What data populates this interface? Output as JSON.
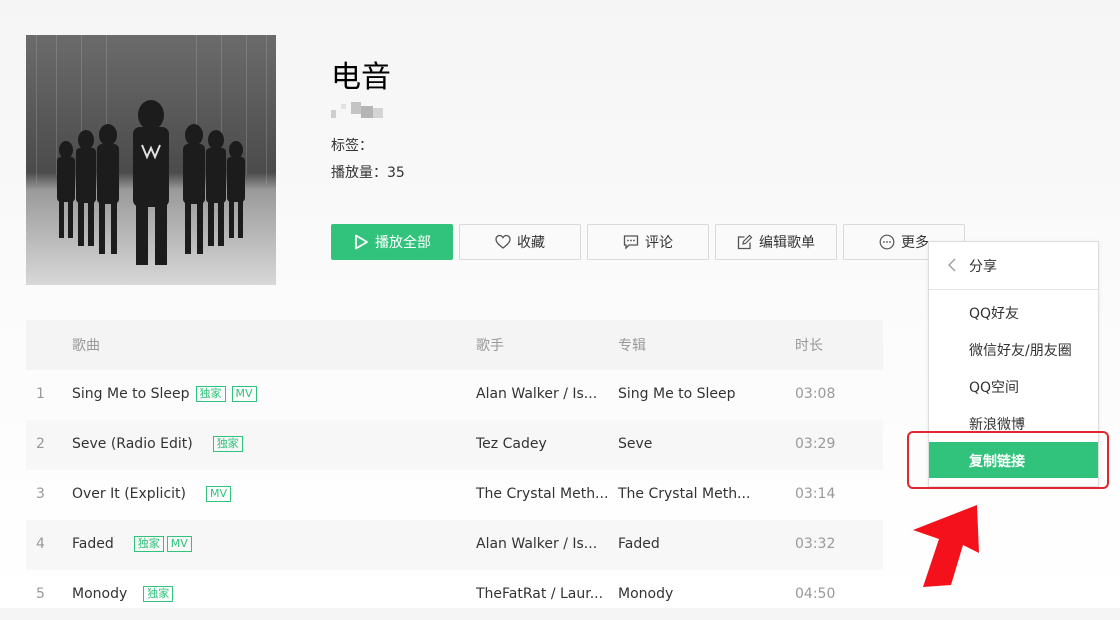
{
  "playlist": {
    "title": "电音",
    "tags_label": "标签：",
    "plays_label": "播放量：",
    "plays_value": "35"
  },
  "actions": {
    "play_all": "播放全部",
    "favorite": "收藏",
    "comment": "评论",
    "edit": "编辑歌单",
    "more": "更多"
  },
  "table": {
    "headers": {
      "song": "歌曲",
      "singer": "歌手",
      "album": "专辑",
      "duration": "时长"
    },
    "rows": [
      {
        "idx": "1",
        "name": "Sing Me to Sleep",
        "tags": [
          "独家",
          "MV"
        ],
        "singer": "Alan Walker / Is...",
        "album": "Sing Me to Sleep",
        "duration": "03:08"
      },
      {
        "idx": "2",
        "name": "Seve (Radio Edit)",
        "tags": [
          "独家"
        ],
        "singer": "Tez Cadey",
        "album": "Seve",
        "duration": "03:29"
      },
      {
        "idx": "3",
        "name": "Over It (Explicit)",
        "tags": [
          "MV"
        ],
        "singer": "The Crystal Meth...",
        "album": "The Crystal Meth...",
        "duration": "03:14"
      },
      {
        "idx": "4",
        "name": "Faded",
        "tags": [
          "独家",
          "MV"
        ],
        "singer": "Alan Walker / Is...",
        "album": "Faded",
        "duration": "03:32"
      },
      {
        "idx": "5",
        "name": "Monody",
        "tags": [
          "独家"
        ],
        "singer": "TheFatRat / Laur...",
        "album": "Monody",
        "duration": "04:50"
      }
    ]
  },
  "share_menu": {
    "title": "分享",
    "items": [
      "QQ好友",
      "微信好友/朋友圈",
      "QQ空间",
      "新浪微博",
      "复制链接"
    ]
  },
  "colors": {
    "accent": "#31c27c",
    "annotation": "#e0262e"
  }
}
